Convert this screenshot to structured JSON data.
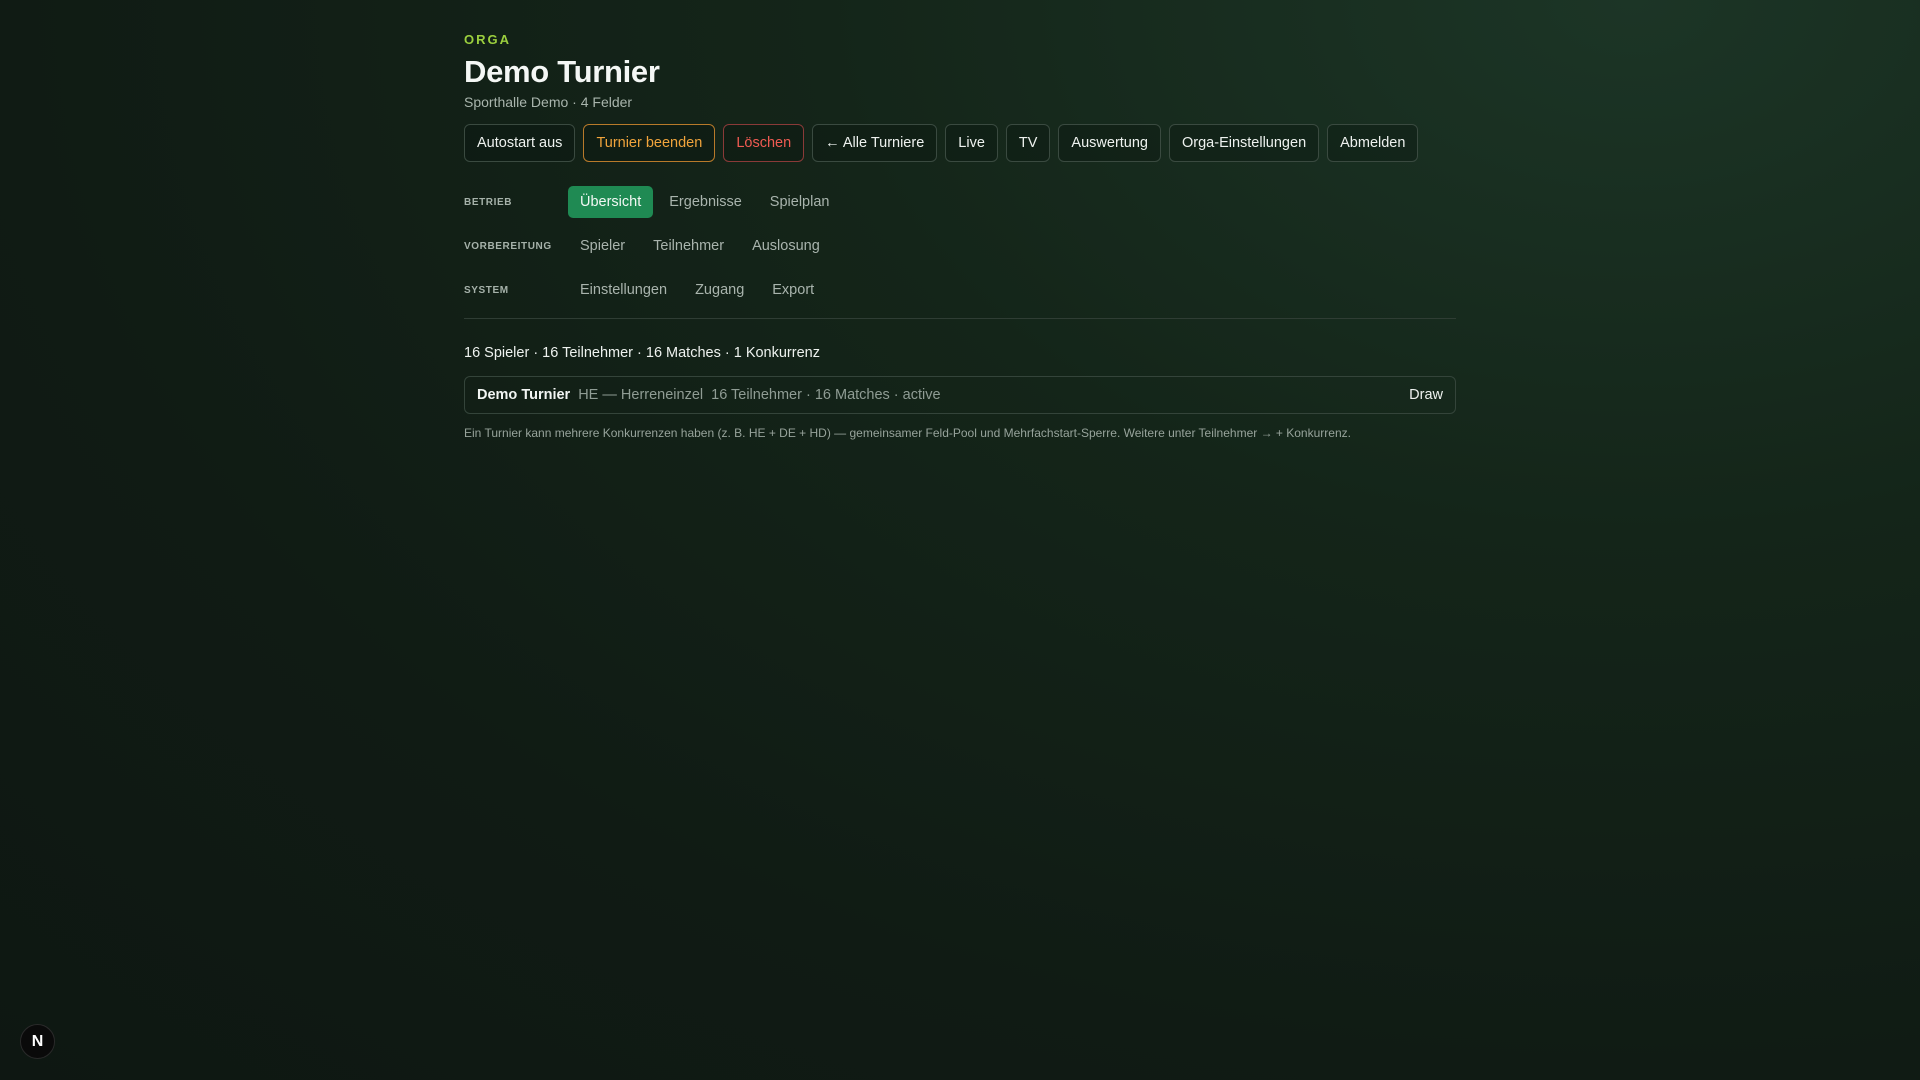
{
  "header": {
    "eyebrow": "ORGA",
    "title": "Demo Turnier",
    "subtitle": "Sporthalle Demo · 4 Felder"
  },
  "actions": {
    "autostart": "Autostart aus",
    "end_tournament": "Turnier beenden",
    "delete": "Löschen",
    "all_tournaments": "← Alle Turniere",
    "live": "Live",
    "tv": "TV",
    "evaluation": "Auswertung",
    "orga_settings": "Orga-Einstellungen",
    "logout": "Abmelden"
  },
  "nav": {
    "groups": [
      {
        "label": "BETRIEB",
        "items": [
          "Übersicht",
          "Ergebnisse",
          "Spielplan"
        ]
      },
      {
        "label": "VORBEREITUNG",
        "items": [
          "Spieler",
          "Teilnehmer",
          "Auslosung"
        ]
      },
      {
        "label": "SYSTEM",
        "items": [
          "Einstellungen",
          "Zugang",
          "Export"
        ]
      }
    ],
    "active": "Übersicht"
  },
  "summary": "16 Spieler · 16 Teilnehmer · 16 Matches · 1 Konkurrenz",
  "competition": {
    "name": "Demo Turnier",
    "type": "HE — Herreneinzel",
    "stats": "16 Teilnehmer · 16 Matches · active",
    "action": "Draw"
  },
  "hint": "Ein Turnier kann mehrere Konkurrenzen haben (z. B. HE + DE + HD) — gemeinsamer Feld-Pool und Mehrfachstart-Sperre. Weitere unter Teilnehmer → + Konkurrenz.",
  "badge": {
    "letter": "N",
    "icon": "nextjs-logo-icon"
  },
  "colors": {
    "accent": "#1f8a53",
    "eyebrow": "#9bcf3e",
    "warn": "#f0a43c",
    "danger": "#ef5b52"
  }
}
